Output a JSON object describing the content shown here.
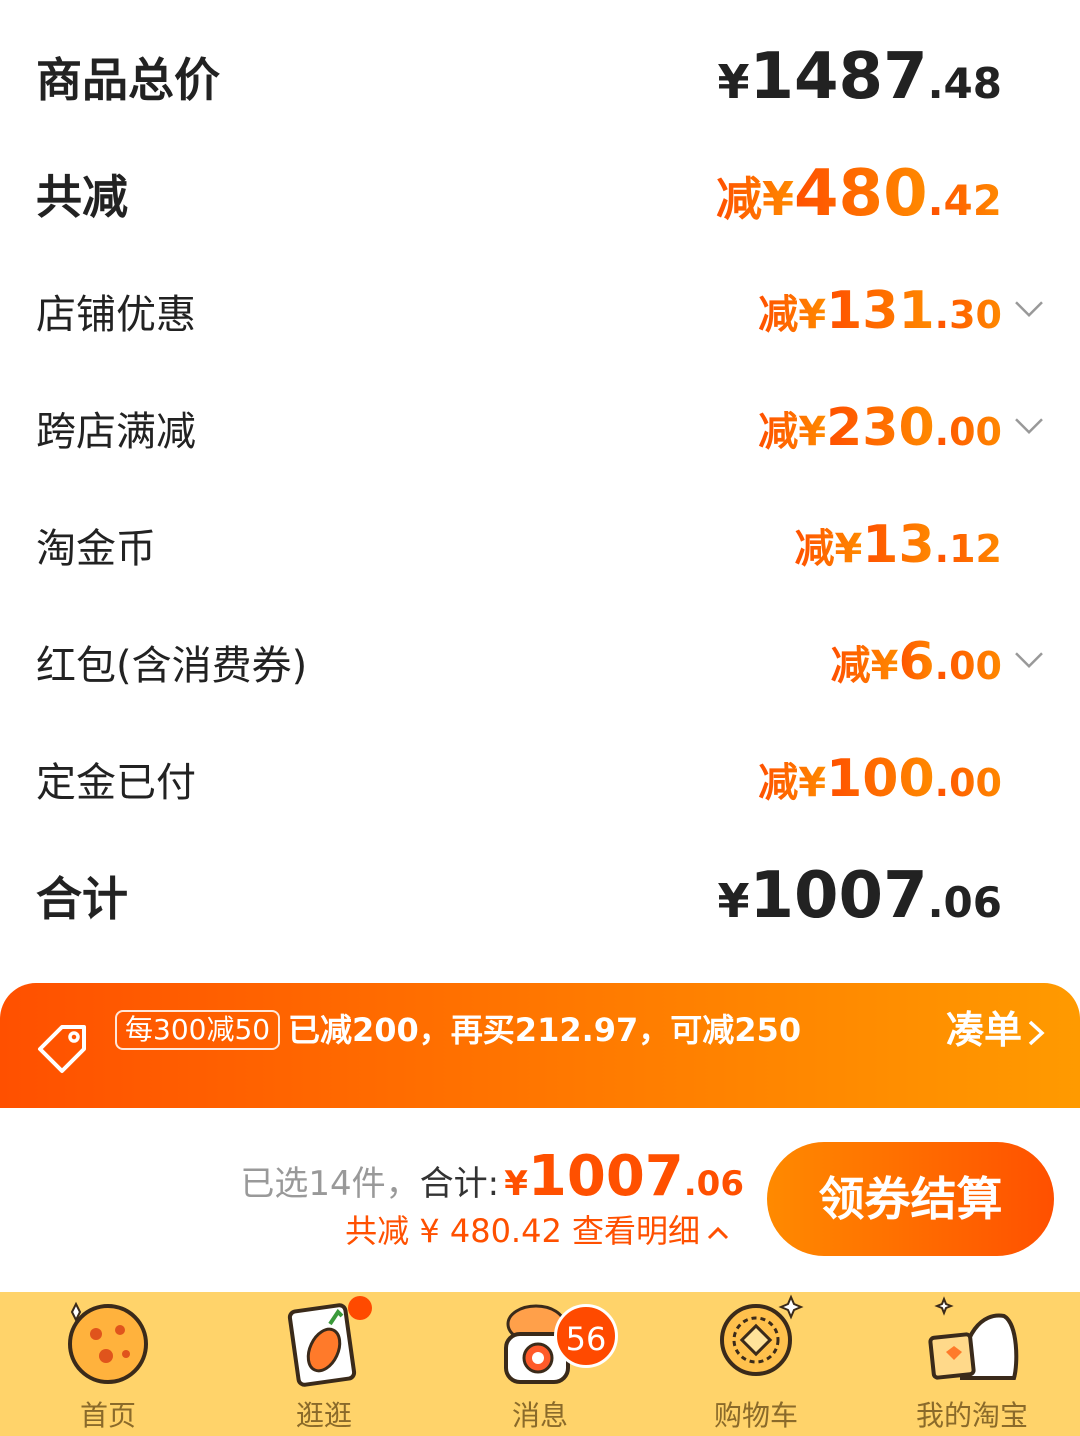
{
  "summary": {
    "rows": [
      {
        "label": "商品总价",
        "prefix": "¥",
        "int": "1487",
        "dec": ".48"
      },
      {
        "label": "共减",
        "prefix": "减¥",
        "int": "480",
        "dec": ".42"
      },
      {
        "label": "店铺优惠",
        "prefix": "减¥",
        "int": "131",
        "dec": ".30"
      },
      {
        "label": "跨店满减",
        "prefix": "减¥",
        "int": "230",
        "dec": ".00"
      },
      {
        "label": "淘金币",
        "prefix": "减¥",
        "int": "13",
        "dec": ".12"
      },
      {
        "label": "红包(含消费券)",
        "prefix": "减¥",
        "int": "6",
        "dec": ".00"
      },
      {
        "label": "定金已付",
        "prefix": "减¥",
        "int": "100",
        "dec": ".00"
      },
      {
        "label": "合计",
        "prefix": "¥",
        "int": "1007",
        "dec": ".06"
      }
    ]
  },
  "promo": {
    "rule": "每300减50",
    "description": "已减200，再买212.97，可减250",
    "action": "凑单"
  },
  "checkout": {
    "selected_text": "已选14件，",
    "total_label": "合计:",
    "total_prefix": "¥",
    "total_int": "1007",
    "total_dec": ".06",
    "discount_text": "共减 ¥ 480.42  查看明细",
    "pay_button": "领券结算"
  },
  "tabbar": {
    "items": [
      {
        "label": "首页",
        "icon": "cookie-home-icon"
      },
      {
        "label": "逛逛",
        "icon": "clipboard-carrot-icon"
      },
      {
        "label": "消息",
        "icon": "mascot-phone-icon"
      },
      {
        "label": "购物车",
        "icon": "mooncake-cart-icon"
      },
      {
        "label": "我的淘宝",
        "icon": "mascot-profile-icon"
      }
    ],
    "message_badge": "56"
  },
  "colors": {
    "accent": "#ff5000",
    "accent_light": "#ff9a00",
    "tabbar_bg": "#ffd36a"
  }
}
